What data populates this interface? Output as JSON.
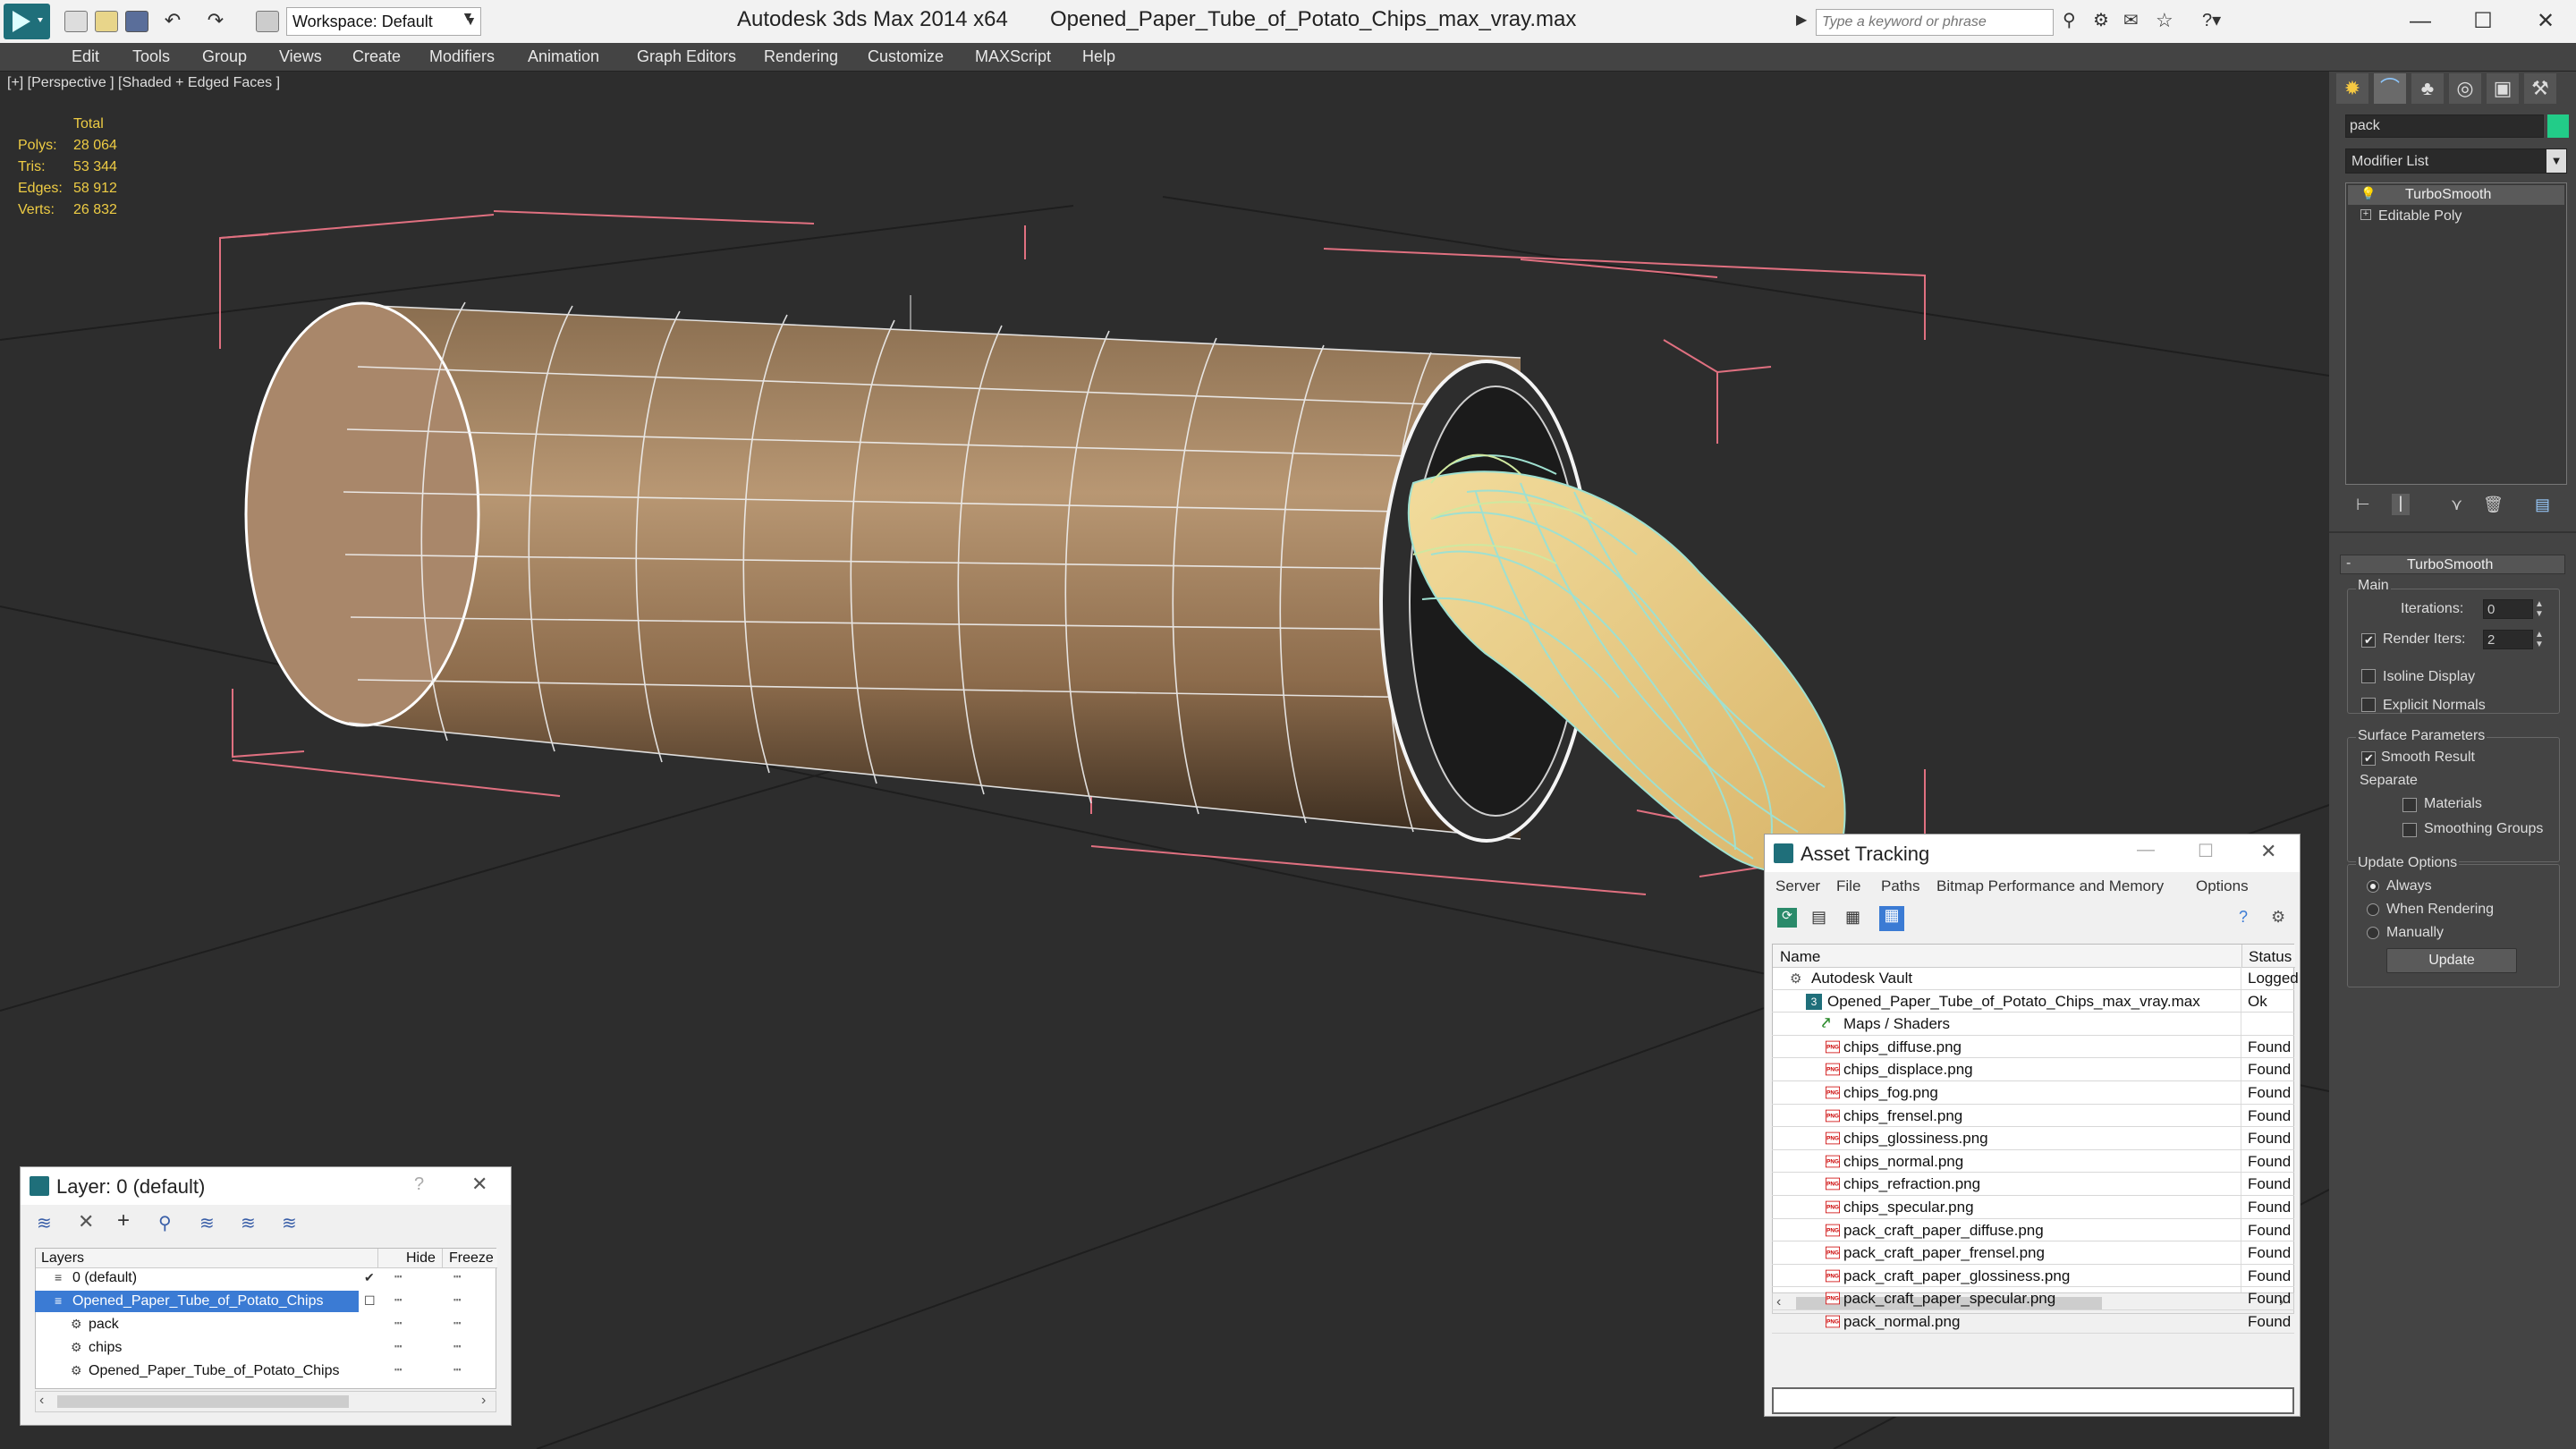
{
  "titlebar": {
    "workspace_label": "Workspace: Default",
    "app_title": "Autodesk 3ds Max  2014 x64",
    "file_title": "Opened_Paper_Tube_of_Potato_Chips_max_vray.max",
    "search_placeholder": "Type a keyword or phrase",
    "minimize": "—",
    "maximize": "☐",
    "close": "✕"
  },
  "menu": [
    "Edit",
    "Tools",
    "Group",
    "Views",
    "Create",
    "Modifiers",
    "Animation",
    "Graph Editors",
    "Rendering",
    "Customize",
    "MAXScript",
    "Help"
  ],
  "viewport": {
    "label": "[+] [Perspective ] [Shaded + Edged Faces ]",
    "stats": {
      "header": "Total",
      "polys_label": "Polys:",
      "polys": "28 064",
      "tris_label": "Tris:",
      "tris": "53 344",
      "edges_label": "Edges:",
      "edges": "58 912",
      "verts_label": "Verts:",
      "verts": "26 832"
    }
  },
  "command_panel": {
    "object_name": "pack",
    "modifier_list": "Modifier List",
    "stack": [
      "TurboSmooth",
      "Editable Poly"
    ],
    "rollout_title": "TurboSmooth",
    "main_label": "Main",
    "iterations_label": "Iterations:",
    "iterations": "0",
    "render_iters_label": "Render Iters:",
    "render_iters": "2",
    "isoline": "Isoline Display",
    "explicit_normals": "Explicit Normals",
    "surface_params": "Surface Parameters",
    "smooth_result": "Smooth Result",
    "separate": "Separate",
    "materials": "Materials",
    "smoothing_groups": "Smoothing Groups",
    "update_options": "Update Options",
    "always": "Always",
    "when_rendering": "When Rendering",
    "manually": "Manually",
    "update_button": "Update"
  },
  "asset_tracking": {
    "title": "Asset Tracking",
    "menu": [
      "Server",
      "File",
      "Paths",
      "Bitmap Performance and Memory",
      "Options"
    ],
    "col_name": "Name",
    "col_status": "Status",
    "vault": {
      "name": "Autodesk Vault",
      "status": "Logged"
    },
    "maxfile": {
      "name": "Opened_Paper_Tube_of_Potato_Chips_max_vray.max",
      "status": "Ok"
    },
    "maps_folder": "Maps / Shaders",
    "files": [
      {
        "name": "chips_diffuse.png",
        "status": "Found"
      },
      {
        "name": "chips_displace.png",
        "status": "Found"
      },
      {
        "name": "chips_fog.png",
        "status": "Found"
      },
      {
        "name": "chips_frensel.png",
        "status": "Found"
      },
      {
        "name": "chips_glossiness.png",
        "status": "Found"
      },
      {
        "name": "chips_normal.png",
        "status": "Found"
      },
      {
        "name": "chips_refraction.png",
        "status": "Found"
      },
      {
        "name": "chips_specular.png",
        "status": "Found"
      },
      {
        "name": "pack_craft_paper_diffuse.png",
        "status": "Found"
      },
      {
        "name": "pack_craft_paper_frensel.png",
        "status": "Found"
      },
      {
        "name": "pack_craft_paper_glossiness.png",
        "status": "Found"
      },
      {
        "name": "pack_craft_paper_specular.png",
        "status": "Found"
      },
      {
        "name": "pack_normal.png",
        "status": "Found"
      }
    ],
    "png_badge": "PNG"
  },
  "layer_dialog": {
    "title": "Layer: 0 (default)",
    "help": "?",
    "col_layers": "Layers",
    "col_hide": "Hide",
    "col_freeze": "Freeze",
    "rows": [
      "0 (default)",
      "Opened_Paper_Tube_of_Potato_Chips",
      "pack",
      "chips",
      "Opened_Paper_Tube_of_Potato_Chips"
    ]
  }
}
